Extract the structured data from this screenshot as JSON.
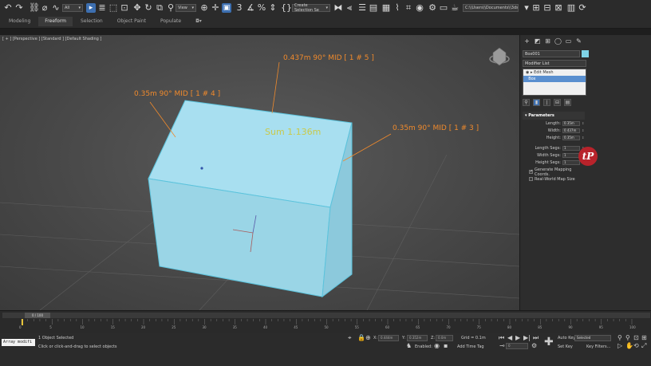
{
  "ribbon_tabs": [
    "Modeling",
    "Freeform",
    "Selection",
    "Object Paint",
    "Populate"
  ],
  "toolbar": {
    "filter_dropdown": "All",
    "view_dropdown": "View",
    "selection_set_dropdown": "Create Selection Se",
    "project_path": "C:\\\\Users\\\\Documents\\\\3dsMax"
  },
  "viewport": {
    "label": "[ + ] [Perspective ] [Standard ] [Default Shading ]",
    "dimension_labels": {
      "top": "0.437m 90° MID [ 1 # 5 ]",
      "left": "0.35m 90° MID [ 1 # 4 ]",
      "right": "0.35m 90° MID [ 1 # 3 ]"
    },
    "sum_label": "Sum 1.136m",
    "box_color": "#a6dbea",
    "label_color": "#f08a2c"
  },
  "command_panel": {
    "object_name": "Box001",
    "object_color": "#7fd3e6",
    "modifier_list": "Modifier List",
    "stack": [
      {
        "label": "Edit Mesh",
        "selected": false
      },
      {
        "label": "Box",
        "selected": true
      }
    ],
    "rollout_title": "Parameters",
    "params": [
      {
        "label": "Length:",
        "value": "0.35m"
      },
      {
        "label": "Width:",
        "value": "0.437m"
      },
      {
        "label": "Height:",
        "value": "0.35m"
      }
    ],
    "segs": [
      {
        "label": "Length Segs:",
        "value": "1"
      },
      {
        "label": "Width Segs:",
        "value": "1"
      },
      {
        "label": "Height Segs:",
        "value": "1"
      }
    ],
    "checkboxes": [
      {
        "label": "Generate Mapping Coords.",
        "checked": true
      },
      {
        "label": "Real-World Map Size",
        "checked": false
      }
    ]
  },
  "logo_text": "tP",
  "timeline": {
    "frame": "0 / 100",
    "ticks": [
      "0",
      "5",
      "10",
      "15",
      "20",
      "25",
      "30",
      "35",
      "40",
      "45",
      "50",
      "55",
      "60",
      "65",
      "70",
      "75",
      "80",
      "85",
      "90",
      "95",
      "100"
    ]
  },
  "status": {
    "script_listener": "Array modifi",
    "selection_info": "1 Object Selected",
    "prompt": "Click or click-and-drag to select objects",
    "x_label": "X:",
    "x_value": "0.444m",
    "y_label": "Y:",
    "y_value": "0.352m",
    "z_label": "Z:",
    "z_value": "0.0m",
    "grid": "Grid = 0.1m",
    "enabled": "Enabled:",
    "add_time_tag": "Add Time Tag",
    "auto_key": "Auto Key",
    "set_key": "Set Key",
    "selected": "Selected",
    "key_filters": "Key Filters...",
    "frame_value": "0"
  }
}
